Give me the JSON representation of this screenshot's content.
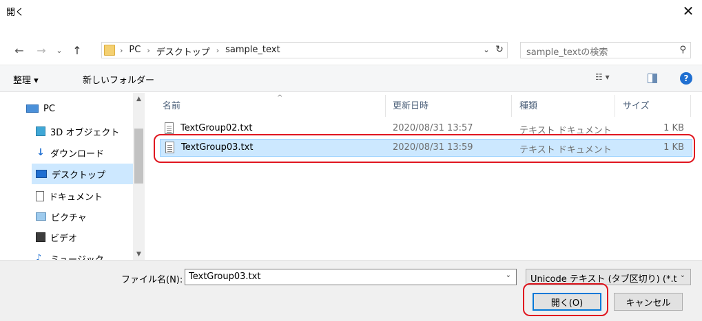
{
  "window": {
    "title": "開く",
    "close_glyph": "✕"
  },
  "nav_buttons": {
    "back": "←",
    "forward": "→",
    "recent": "⌄",
    "up": "↑"
  },
  "address": {
    "crumbs": [
      "PC",
      "デスクトップ",
      "sample_text"
    ],
    "separator": "›",
    "dropdown_glyph": "⌄",
    "refresh_glyph": "↻"
  },
  "search": {
    "placeholder": "sample_textの検索",
    "icon_glyph": "⚲"
  },
  "toolbar": {
    "organize_label": "整理 ▾",
    "new_folder_label": "新しいフォルダー",
    "view_label": "☷ ▾",
    "help_label": "?"
  },
  "nav_pane": {
    "items": [
      {
        "label": "PC",
        "icon": "pc-icon"
      },
      {
        "label": "3D オブジェクト",
        "icon": "3d-objects-icon"
      },
      {
        "label": "ダウンロード",
        "icon": "download-icon"
      },
      {
        "label": "デスクトップ",
        "icon": "desktop-icon",
        "selected": true
      },
      {
        "label": "ドキュメント",
        "icon": "documents-icon"
      },
      {
        "label": "ピクチャ",
        "icon": "pictures-icon"
      },
      {
        "label": "ビデオ",
        "icon": "videos-icon"
      },
      {
        "label": "ミュージック",
        "icon": "music-icon"
      }
    ],
    "scroll_up": "▲",
    "scroll_down": "▼"
  },
  "file_list": {
    "columns": [
      "名前",
      "更新日時",
      "種類",
      "サイズ"
    ],
    "sort_caret": "^",
    "rows": [
      {
        "name": "TextGroup02.txt",
        "modified": "2020/08/31 13:57",
        "type": "テキスト ドキュメント",
        "size": "1 KB",
        "selected": false
      },
      {
        "name": "TextGroup03.txt",
        "modified": "2020/08/31 13:59",
        "type": "テキスト ドキュメント",
        "size": "1 KB",
        "selected": true
      }
    ]
  },
  "footer": {
    "filename_label": "ファイル名(N):",
    "filename_value": "TextGroup03.txt",
    "filetype_value": "Unicode テキスト (タブ区切り) (*.txt)",
    "dropdown_glyph": "⌄",
    "open_label": "開く(O)",
    "cancel_label": "キャンセル"
  },
  "colors": {
    "annotation_red": "#e0161f",
    "selection_blue": "#cce8ff",
    "accent": "#0078d7"
  }
}
